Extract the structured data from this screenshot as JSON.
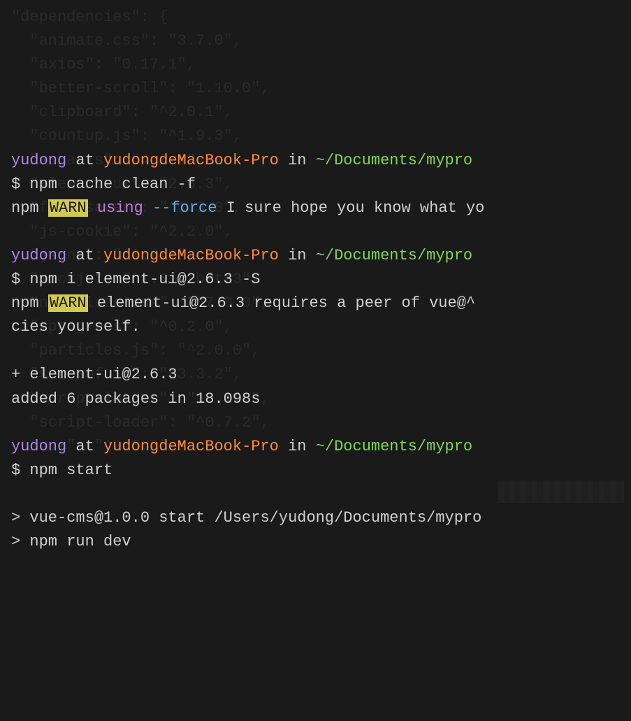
{
  "bg": {
    "l0": "\"dependencies\": {",
    "l1": "  \"animate.css\": \"3.7.0\",",
    "l2": "  \"axios\": \"0.17.1\",",
    "l3": "  \"better-scroll\": \"1.10.0\",",
    "l4": "  \"clipboard\": \"^2.0.1\",",
    "l5": "  \"countup.js\": \"^1.9.3\",",
    "l6": "  \"echarts\": \"4.0.4\",",
    "l7": "  \"element-ui\": \"2.6.3\",",
    "l8": "  \"file-saver\": \"^1.3.8\",",
    "l9": "  \"js-cookie\": \"^2.2.0\",",
    "l10": "  \"jsonp\": \"^0.2.1\",",
    "l11": "  \"mockjs\": \"^1.0.1-beta3\",",
    "l12": "  \"normalize.css\": \"^7.0.0\",",
    "l13": "  \"nprogress\": \"^0.2.0\",",
    "l14": "  \"particles.js\": \"^2.0.0\",",
    "l15": "  \"screenfull\": \"^3.3.2\",",
    "l16": "  \"script-loader\": \"^0.1.0\",",
    "l17": "  \"script-loader\": \"^0.7.2\",",
    "l18": "  \"vue\": \"^2.5.2\""
  },
  "p1": {
    "user": "yudong",
    "at": " at ",
    "host": "yudongdeMacBook-Pro",
    "in": " in ",
    "path": "~/Documents/mypro"
  },
  "c1": {
    "prompt": "$ ",
    "cmd": "npm cache clean -f"
  },
  "w1": {
    "prefix": "npm ",
    "badge": "WARN",
    "using": " using ",
    "force": "--force",
    "msg": " I sure hope you know what yo"
  },
  "p2": {
    "user": "yudong",
    "at": " at ",
    "host": "yudongdeMacBook-Pro",
    "in": " in ",
    "path": "~/Documents/mypro"
  },
  "c2": {
    "prompt": "$ ",
    "cmd": "npm i element-ui@2.6.3 -S"
  },
  "w2": {
    "prefix": "npm ",
    "badge": "WARN",
    "msg": " element-ui@2.6.3 requires a peer of vue@^"
  },
  "w2b": "cies yourself.",
  "o1": "+ element-ui@2.6.3",
  "o2": "added 6 packages in 18.098s",
  "p3": {
    "user": "yudong",
    "at": " at ",
    "host": "yudongdeMacBook-Pro",
    "in": " in ",
    "path": "~/Documents/mypro"
  },
  "c3": {
    "prompt": "$ ",
    "cmd": "npm start"
  },
  "o3": "> vue-cms@1.0.0 start /Users/yudong/Documents/mypro",
  "o4": "> npm run dev"
}
